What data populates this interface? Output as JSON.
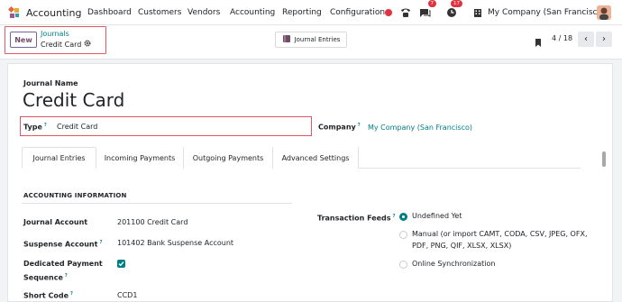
{
  "navbar": {
    "app_name": "Accounting",
    "menu": [
      "Dashboard",
      "Customers",
      "Vendors",
      "Accounting",
      "Reporting",
      "Configuration"
    ],
    "messages_count": "7",
    "activities_count": "17",
    "company": "My Company (San Francisco)"
  },
  "control_panel": {
    "new_label": "New",
    "breadcrumb_parent": "Journals",
    "breadcrumb_current": "Credit Card",
    "smart_button": "Journal Entries",
    "pager": "4 / 18"
  },
  "form": {
    "name_label": "Journal Name",
    "name": "Credit Card",
    "type_label": "Type",
    "type_value": "Credit Card",
    "company_label": "Company",
    "company_value": "My Company (San Francisco)",
    "tooltip_mark": "?",
    "tabs": [
      "Journal Entries",
      "Incoming Payments",
      "Outgoing Payments",
      "Advanced Settings"
    ],
    "section_title": "ACCOUNTING INFORMATION",
    "fields": {
      "journal_account_label": "Journal Account",
      "journal_account_value": "201100 Credit Card",
      "suspense_account_label": "Suspense Account",
      "suspense_account_value": "101402 Bank Suspense Account",
      "dedicated_seq_label_1": "Dedicated Payment",
      "dedicated_seq_label_2": "Sequence",
      "dedicated_seq_checked": true,
      "short_code_label": "Short Code",
      "short_code_value": "CCD1"
    },
    "transaction_feeds": {
      "label": "Transaction Feeds",
      "options": [
        "Undefined Yet",
        "Manual (or import CAMT, CODA, CSV, JPEG, OFX,",
        "PDF, PNG, QIF, XLSX, XLSX)",
        "Online Synchronization"
      ],
      "selected": "Undefined Yet"
    }
  },
  "colors": {
    "accent": "#017e84",
    "brand": "#714b67",
    "highlight": "#e05a63",
    "badge": "#e0333f"
  }
}
